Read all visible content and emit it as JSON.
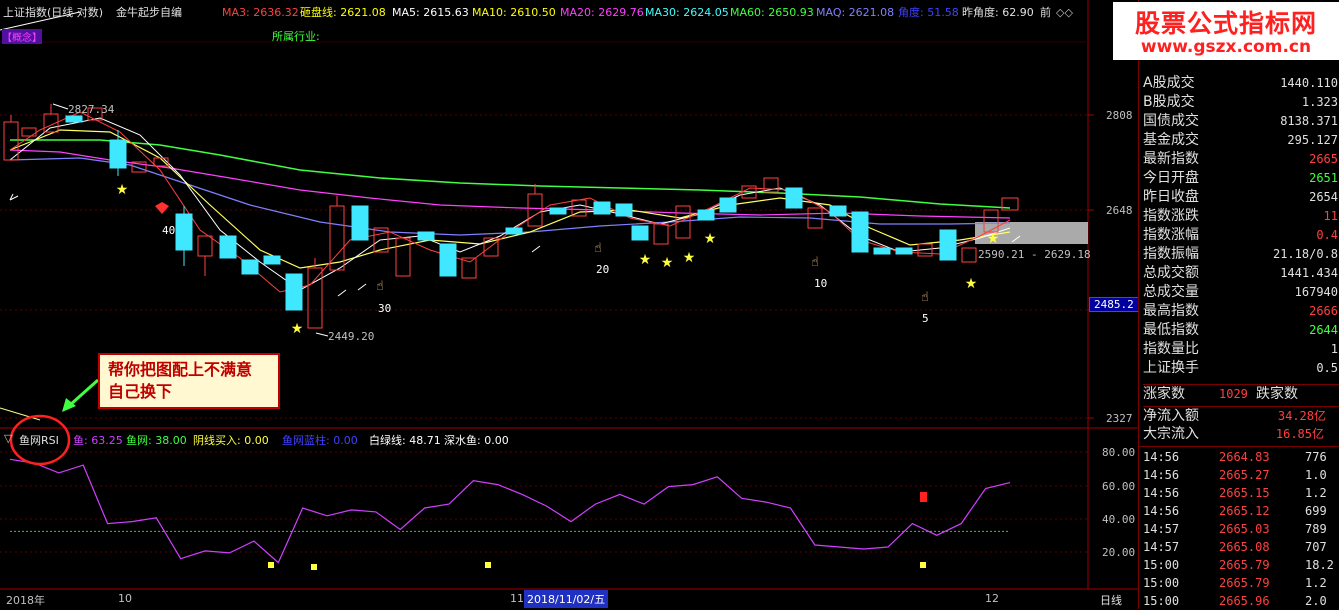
{
  "header": {
    "index_name": "上证指数(日线 对数)",
    "formula_name": "金牛起步自编",
    "ma3": "MA3: 2636.32",
    "zadi": "砸盘线: 2621.08",
    "ma5": "MA5: 2615.63",
    "ma10": "MA10: 2610.50",
    "ma20": "MA20: 2629.76",
    "ma30": "MA30: 2624.05",
    "ma60": "MA60: 2650.93",
    "maq": "MAQ: 2621.08",
    "jiaodu": "角度: 51.58",
    "zuo_jiaodu": "昨角度: 62.90",
    "qian": "前",
    "tag_label": "【概念】",
    "industry": "所属行业:",
    "colors": {
      "ma3": "#ff4040",
      "zadi": "#ffff00",
      "ma5": "#ffffff",
      "ma10": "#ffff00",
      "ma20": "#ff40ff",
      "ma30": "#40ffff",
      "ma60": "#40ff40",
      "maq": "#8080ff",
      "jiaodu": "#4040ff"
    }
  },
  "logo": {
    "title": "股票公式指标网",
    "url": "www.gszx.com.cn"
  },
  "price_axis": {
    "labels": [
      "2808",
      "2648",
      "2485.2",
      "2327"
    ],
    "current": "2485.2"
  },
  "annotations": {
    "high": "2827.34",
    "low": "2449.20",
    "range": "2590.21 - 2629.18",
    "n40": "40",
    "n30": "30",
    "n20": "20",
    "n10": "10",
    "n5": "5"
  },
  "callout": {
    "line1": "帮你把图配上不满意",
    "line2": "自己换下"
  },
  "indicator": {
    "name": "鱼网RSI",
    "yu": "鱼: 63.25",
    "yuwang": "鱼网: 38.00",
    "yinxian": "阴线买入: 0.00",
    "lanzhu": "鱼网蓝柱: 0.00",
    "bailv": "白绿线: 48.71",
    "shenshui": "深水鱼: 0.00",
    "axis": [
      "80.00",
      "60.00",
      "40.00",
      "20.00"
    ],
    "chart_data": {
      "type": "line",
      "series": [
        {
          "name": "鱼",
          "values": [
            75,
            73,
            68,
            72,
            42,
            43,
            45,
            24,
            28,
            27,
            33,
            22,
            50,
            46,
            49,
            48,
            39,
            50,
            52,
            64,
            62,
            57,
            51,
            43,
            52,
            57,
            52,
            61,
            62,
            66,
            55,
            53,
            50,
            31,
            30,
            29,
            30,
            42,
            36,
            42,
            60,
            63
          ]
        },
        {
          "name": "鱼网",
          "values": [
            38,
            38,
            38,
            38,
            38,
            38,
            38,
            38,
            38,
            38,
            38,
            38,
            38,
            38,
            38,
            38,
            38,
            38,
            38,
            38,
            38,
            38,
            38,
            38,
            38,
            38,
            38,
            38,
            38,
            38,
            38,
            38,
            38,
            38,
            38,
            38,
            38,
            38,
            38,
            38,
            38,
            38
          ]
        }
      ],
      "ylim": [
        10,
        90
      ]
    }
  },
  "bottom": {
    "year": "2018年",
    "m10": "10",
    "m11": "11",
    "date": "2018/11/02/五",
    "m12": "12",
    "period": "日线"
  },
  "right_panel": {
    "stats": [
      {
        "label": "A股成交",
        "value": "1440.110",
        "color": "#e0e0e0"
      },
      {
        "label": "B股成交",
        "value": "1.323",
        "color": "#e0e0e0"
      },
      {
        "label": "国债成交",
        "value": "8138.371",
        "color": "#e0e0e0"
      },
      {
        "label": "基金成交",
        "value": "295.127",
        "color": "#e0e0e0"
      },
      {
        "label": "最新指数",
        "value": "2665",
        "color": "#ff4040"
      },
      {
        "label": "今日开盘",
        "value": "2651",
        "color": "#40ff40"
      },
      {
        "label": "昨日收盘",
        "value": "2654",
        "color": "#e0e0e0"
      },
      {
        "label": "指数涨跌",
        "value": "11",
        "color": "#ff4040"
      },
      {
        "label": "指数涨幅",
        "value": "0.4",
        "color": "#ff4040"
      },
      {
        "label": "指数振幅",
        "value": "21.18/0.8",
        "color": "#e0e0e0"
      },
      {
        "label": "总成交额",
        "value": "1441.434",
        "color": "#e0e0e0"
      },
      {
        "label": "总成交量",
        "value": "167940",
        "color": "#e0e0e0"
      },
      {
        "label": "最高指数",
        "value": "2666",
        "color": "#ff4040"
      },
      {
        "label": "最低指数",
        "value": "2644",
        "color": "#40ff40"
      },
      {
        "label": "指数量比",
        "value": "1",
        "color": "#e0e0e0"
      },
      {
        "label": "上证换手",
        "value": "0.5",
        "color": "#e0e0e0"
      }
    ],
    "up_label": "涨家数",
    "up_count": "1029",
    "down_label": "跌家数",
    "inflow_label": "净流入额",
    "inflow_value": "34.28亿",
    "block_label": "大宗流入",
    "block_value": "16.85亿",
    "ticks": [
      {
        "time": "14:56",
        "price": "2664.83",
        "vol": "776"
      },
      {
        "time": "14:56",
        "price": "2665.27",
        "vol": "1.0"
      },
      {
        "time": "14:56",
        "price": "2665.15",
        "vol": "1.2"
      },
      {
        "time": "14:56",
        "price": "2665.12",
        "vol": "699"
      },
      {
        "time": "14:57",
        "price": "2665.03",
        "vol": "789"
      },
      {
        "time": "14:57",
        "price": "2665.08",
        "vol": "707"
      },
      {
        "time": "15:00",
        "price": "2665.79",
        "vol": "18.2"
      },
      {
        "time": "15:00",
        "price": "2665.79",
        "vol": "1.2"
      },
      {
        "time": "15:00",
        "price": "2665.96",
        "vol": "2.0"
      }
    ]
  }
}
